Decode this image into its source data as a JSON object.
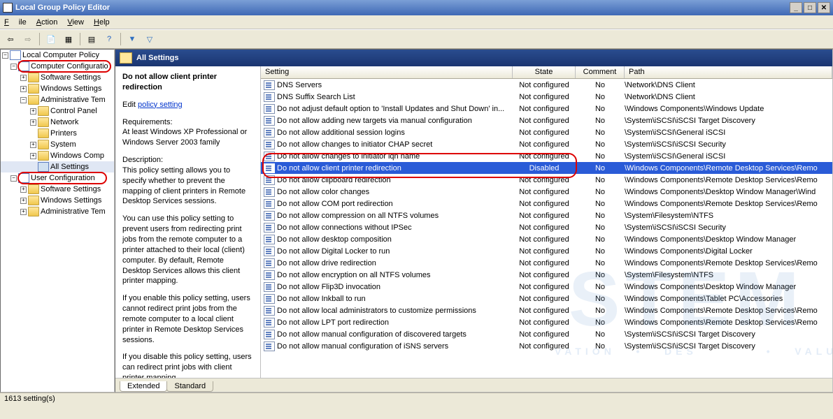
{
  "window": {
    "title": "Local Group Policy Editor"
  },
  "menu": {
    "file": "File",
    "action": "Action",
    "view": "View",
    "help": "Help"
  },
  "tree": {
    "root": "Local Computer Policy",
    "comp": "Computer Configuratio",
    "comp_sw": "Software Settings",
    "comp_win": "Windows Settings",
    "comp_adm": "Administrative Tem",
    "cp": "Control Panel",
    "net": "Network",
    "prn": "Printers",
    "sys": "System",
    "wcomp": "Windows Comp",
    "allset": "All Settings",
    "user": "User Configuration",
    "user_sw": "Software Settings",
    "user_win": "Windows Settings",
    "user_adm": "Administrative Tem"
  },
  "header": {
    "title": "All Settings"
  },
  "desc": {
    "title": "Do not allow client printer redirection",
    "editlabel": "Edit",
    "editlink": "policy setting",
    "req_h": "Requirements:",
    "req": "At least Windows XP Professional or Windows Server 2003 family",
    "desc_h": "Description:",
    "p1": "This policy setting allows you to specify whether to prevent the mapping of client printers in Remote Desktop Services sessions.",
    "p2": "You can use this policy setting to prevent users from redirecting print jobs from the remote computer to a printer attached to their local (client) computer. By default, Remote Desktop Services allows this client printer mapping.",
    "p3": "If you enable this policy setting, users cannot redirect print jobs from the remote computer to a local client printer in Remote Desktop Services sessions.",
    "p4": "If you disable this policy setting, users can redirect print jobs with client printer mapping."
  },
  "cols": {
    "c1": "Setting",
    "c2": "State",
    "c3": "Comment",
    "c4": "Path"
  },
  "rows": [
    {
      "s": "DNS Servers",
      "st": "Not configured",
      "c": "No",
      "p": "\\Network\\DNS Client"
    },
    {
      "s": "DNS Suffix Search List",
      "st": "Not configured",
      "c": "No",
      "p": "\\Network\\DNS Client"
    },
    {
      "s": "Do not adjust default option to 'Install Updates and Shut Down' in...",
      "st": "Not configured",
      "c": "No",
      "p": "\\Windows Components\\Windows Update"
    },
    {
      "s": "Do not allow adding new targets via manual configuration",
      "st": "Not configured",
      "c": "No",
      "p": "\\System\\iSCSI\\iSCSI Target Discovery"
    },
    {
      "s": "Do not allow additional session logins",
      "st": "Not configured",
      "c": "No",
      "p": "\\System\\iSCSI\\General iSCSI"
    },
    {
      "s": "Do not allow changes to initiator CHAP secret",
      "st": "Not configured",
      "c": "No",
      "p": "\\System\\iSCSI\\iSCSI Security"
    },
    {
      "s": "Do not allow changes to initiator iqn name",
      "st": "Not configured",
      "c": "No",
      "p": "\\System\\iSCSI\\General iSCSI"
    },
    {
      "s": "Do not allow client printer redirection",
      "st": "Disabled",
      "c": "No",
      "p": "\\Windows Components\\Remote Desktop Services\\Remo",
      "sel": true
    },
    {
      "s": "Do not allow clipboard redirection",
      "st": "Not configured",
      "c": "No",
      "p": "\\Windows Components\\Remote Desktop Services\\Remo"
    },
    {
      "s": "Do not allow color changes",
      "st": "Not configured",
      "c": "No",
      "p": "\\Windows Components\\Desktop Window Manager\\Wind"
    },
    {
      "s": "Do not allow COM port redirection",
      "st": "Not configured",
      "c": "No",
      "p": "\\Windows Components\\Remote Desktop Services\\Remo"
    },
    {
      "s": "Do not allow compression on all NTFS volumes",
      "st": "Not configured",
      "c": "No",
      "p": "\\System\\Filesystem\\NTFS"
    },
    {
      "s": "Do not allow connections without IPSec",
      "st": "Not configured",
      "c": "No",
      "p": "\\System\\iSCSI\\iSCSI Security"
    },
    {
      "s": "Do not allow desktop composition",
      "st": "Not configured",
      "c": "No",
      "p": "\\Windows Components\\Desktop Window Manager"
    },
    {
      "s": "Do not allow Digital Locker to run",
      "st": "Not configured",
      "c": "No",
      "p": "\\Windows Components\\Digital Locker"
    },
    {
      "s": "Do not allow drive redirection",
      "st": "Not configured",
      "c": "No",
      "p": "\\Windows Components\\Remote Desktop Services\\Remo"
    },
    {
      "s": "Do not allow encryption on all NTFS volumes",
      "st": "Not configured",
      "c": "No",
      "p": "\\System\\Filesystem\\NTFS"
    },
    {
      "s": "Do not allow Flip3D invocation",
      "st": "Not configured",
      "c": "No",
      "p": "\\Windows Components\\Desktop Window Manager"
    },
    {
      "s": "Do not allow Inkball to run",
      "st": "Not configured",
      "c": "No",
      "p": "\\Windows Components\\Tablet PC\\Accessories"
    },
    {
      "s": "Do not allow local administrators to customize permissions",
      "st": "Not configured",
      "c": "No",
      "p": "\\Windows Components\\Remote Desktop Services\\Remo"
    },
    {
      "s": "Do not allow LPT port redirection",
      "st": "Not configured",
      "c": "No",
      "p": "\\Windows Components\\Remote Desktop Services\\Remo"
    },
    {
      "s": "Do not allow manual configuration of discovered targets",
      "st": "Not configured",
      "c": "No",
      "p": "\\System\\iSCSI\\iSCSI Target Discovery"
    },
    {
      "s": "Do not allow manual configuration of iSNS servers",
      "st": "Not configured",
      "c": "No",
      "p": "\\System\\iSCSI\\iSCSI Target Discovery"
    }
  ],
  "tabs": {
    "ext": "Extended",
    "std": "Standard"
  },
  "status": "1613 setting(s)"
}
